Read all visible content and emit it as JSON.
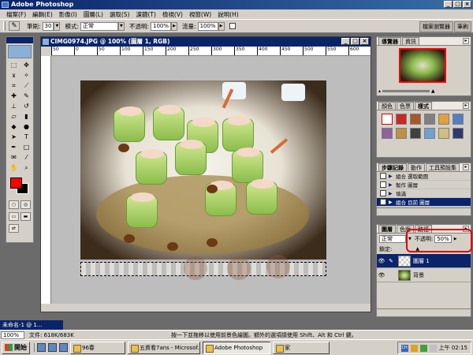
{
  "app": {
    "title": "Adobe Photoshop"
  },
  "menu": [
    "檔案(F)",
    "編輯(E)",
    "影像(I)",
    "圖層(L)",
    "選取(S)",
    "濾鏡(T)",
    "檢視(V)",
    "視窗(W)",
    "說明(H)"
  ],
  "options": {
    "brush_label": "筆刷:",
    "brush_size": "30",
    "mode_label": "模式:",
    "mode_value": "正常",
    "opacity_label": "不透明:",
    "opacity_value": "100%",
    "flow_label": "流量:",
    "flow_value": "100%"
  },
  "palette_well": [
    "檔案瀏覽器",
    "筆刷"
  ],
  "document": {
    "title": "CIMG0974.JPG @ 100% (圖層 1, RGB)",
    "ruler_marks": [
      "50",
      "0",
      "50",
      "100",
      "150",
      "200",
      "250",
      "300",
      "350",
      "400",
      "450",
      "500",
      "550",
      "600"
    ]
  },
  "navigator": {
    "tabs": [
      "導覽器",
      "資訊"
    ]
  },
  "swatches": {
    "tabs": [
      "顏色",
      "色票",
      "樣式"
    ]
  },
  "history": {
    "tabs": [
      "步驟記錄",
      "動作",
      "工具預設集"
    ],
    "items": [
      {
        "label": "組合 選取範圍",
        "selected": false
      },
      {
        "label": "製作 圖層",
        "selected": false
      },
      {
        "label": "填滿",
        "selected": false
      },
      {
        "label": "組合 目前 圖層",
        "selected": true
      }
    ]
  },
  "layers": {
    "tabs": [
      "圖層",
      "色版",
      "路徑"
    ],
    "blend_mode": "正常",
    "opacity_label": "不透明:",
    "opacity_value": "50%",
    "lock_label": "鎖定:",
    "items": [
      {
        "name": "圖層 1",
        "selected": true
      },
      {
        "name": "背景",
        "selected": false
      }
    ]
  },
  "status": {
    "zoom": "100%",
    "doc_info": "文件: 618K/683K",
    "hint": "按一下並拖移以使用前景色繪圖。額外的選項請使用 Shift、Alt 和 Ctrl 鍵。"
  },
  "mini_doc": {
    "title": "未命名-1 @ 1..."
  },
  "taskbar": {
    "start": "開始",
    "tasks": [
      {
        "label": "96春",
        "active": false
      },
      {
        "label": "五資看7ans - Microsof...",
        "active": false
      },
      {
        "label": "Adobe Photoshop",
        "active": true
      },
      {
        "label": "家",
        "active": false
      }
    ],
    "clock": "上午 02:15",
    "ime": "CH"
  },
  "colors": {
    "foreground": "#ff0000",
    "background": "#000000",
    "highlight": "#e00000",
    "title_bar": "#0a246a"
  }
}
